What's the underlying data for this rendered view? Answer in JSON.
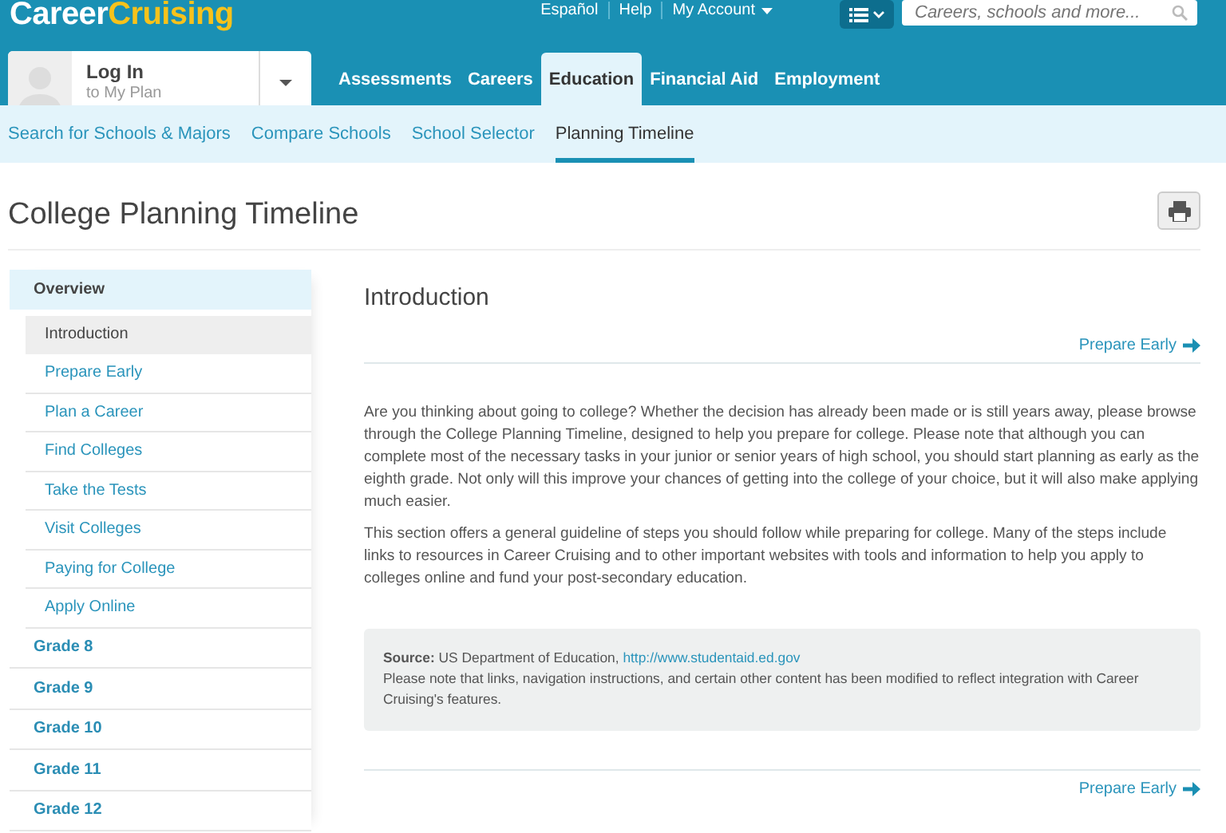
{
  "header": {
    "logo": {
      "first": "Career",
      "second": "Cruising"
    },
    "top_links": [
      "Español",
      "Help",
      "My Account"
    ],
    "search": {
      "placeholder": "Careers, schools and more..."
    }
  },
  "login": {
    "title": "Log In",
    "subtitle": "to My Plan"
  },
  "main_nav": [
    {
      "label": "Assessments",
      "selected": false
    },
    {
      "label": "Careers",
      "selected": false
    },
    {
      "label": "Education",
      "selected": true
    },
    {
      "label": "Financial Aid",
      "selected": false
    },
    {
      "label": "Employment",
      "selected": false
    }
  ],
  "sub_nav": [
    {
      "label": "Search for Schools & Majors",
      "selected": false
    },
    {
      "label": "Compare Schools",
      "selected": false
    },
    {
      "label": "School Selector",
      "selected": false
    },
    {
      "label": "Planning Timeline",
      "selected": true
    }
  ],
  "page_title": "College Planning Timeline",
  "sidebar": {
    "items": [
      {
        "label": "Overview",
        "expanded": true,
        "children": [
          {
            "label": "Introduction",
            "selected": true
          },
          {
            "label": "Prepare Early",
            "selected": false
          },
          {
            "label": "Plan a Career",
            "selected": false
          },
          {
            "label": "Find Colleges",
            "selected": false
          },
          {
            "label": "Take the Tests",
            "selected": false
          },
          {
            "label": "Visit Colleges",
            "selected": false
          },
          {
            "label": "Paying for College",
            "selected": false
          },
          {
            "label": "Apply Online",
            "selected": false
          }
        ]
      },
      {
        "label": "Grade 8",
        "expanded": false
      },
      {
        "label": "Grade 9",
        "expanded": false
      },
      {
        "label": "Grade 10",
        "expanded": false
      },
      {
        "label": "Grade 11",
        "expanded": false
      },
      {
        "label": "Grade 12",
        "expanded": false
      }
    ]
  },
  "content": {
    "heading": "Introduction",
    "next_link_top": "Prepare Early",
    "paragraphs": [
      "Are you thinking about going to college? Whether the decision has already been made or is still years away, please browse through the College Planning Timeline, designed to help you prepare for college. Please note that although you can complete most of the necessary tasks in your junior or senior years of high school, you should start planning as early as the eighth grade. Not only will this improve your chances of getting into the college of your choice, but it will also make applying much easier.",
      "This section offers a general guideline of steps you should follow while preparing for college. Many of the steps include links to resources in Career Cruising and to other important websites with tools and information to help you apply to colleges online and fund your post-secondary education."
    ],
    "source": {
      "text": "**Source:** US Department of Education, ",
      "link": "http://www.studentaid.ed.gov",
      "note": "Please note that links, navigation instructions, and certain other content has been modified to reflect integration with Career Cruising's features."
    },
    "next_link_bottom": "Prepare Early"
  }
}
